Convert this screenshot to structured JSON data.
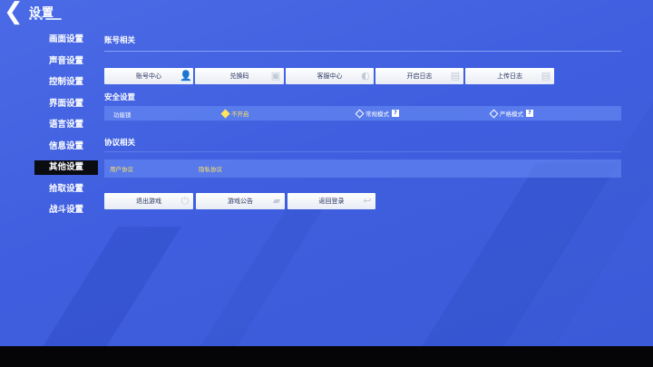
{
  "header": {
    "title": "设置"
  },
  "sidebar": {
    "items": [
      {
        "label": "画面设置",
        "active": false
      },
      {
        "label": "声音设置",
        "active": false
      },
      {
        "label": "控制设置",
        "active": false
      },
      {
        "label": "界面设置",
        "active": false
      },
      {
        "label": "语言设置",
        "active": false
      },
      {
        "label": "信息设置",
        "active": false
      },
      {
        "label": "其他设置",
        "active": true
      },
      {
        "label": "拾取设置",
        "active": false
      },
      {
        "label": "战斗设置",
        "active": false
      }
    ]
  },
  "account": {
    "title": "账号相关",
    "buttons": [
      {
        "label": "账号中心",
        "icon": "user-icon"
      },
      {
        "label": "兑换码",
        "icon": "ticket-icon"
      },
      {
        "label": "客服中心",
        "icon": "headset-icon"
      },
      {
        "label": "开启日志",
        "icon": "document-icon"
      },
      {
        "label": "上传日志",
        "icon": "document-icon"
      }
    ]
  },
  "security": {
    "title": "安全设置",
    "row_label": "功能锁",
    "options": [
      {
        "label": "不开启",
        "selected": true,
        "help": false
      },
      {
        "label": "常规模式",
        "selected": false,
        "help": true
      },
      {
        "label": "严格模式",
        "selected": false,
        "help": true
      }
    ],
    "help_glyph": "?"
  },
  "agreement": {
    "title": "协议相关",
    "links": [
      "用户协议",
      "隐私协议"
    ]
  },
  "system": {
    "buttons": [
      {
        "label": "退出游戏",
        "icon": "power-icon"
      },
      {
        "label": "游戏公告",
        "icon": "megaphone-icon"
      },
      {
        "label": "返回登录",
        "icon": "return-icon"
      }
    ]
  },
  "colors": {
    "background": "#4263e2",
    "highlight": "#ffe45c",
    "active_tab": "#0a0c12"
  }
}
